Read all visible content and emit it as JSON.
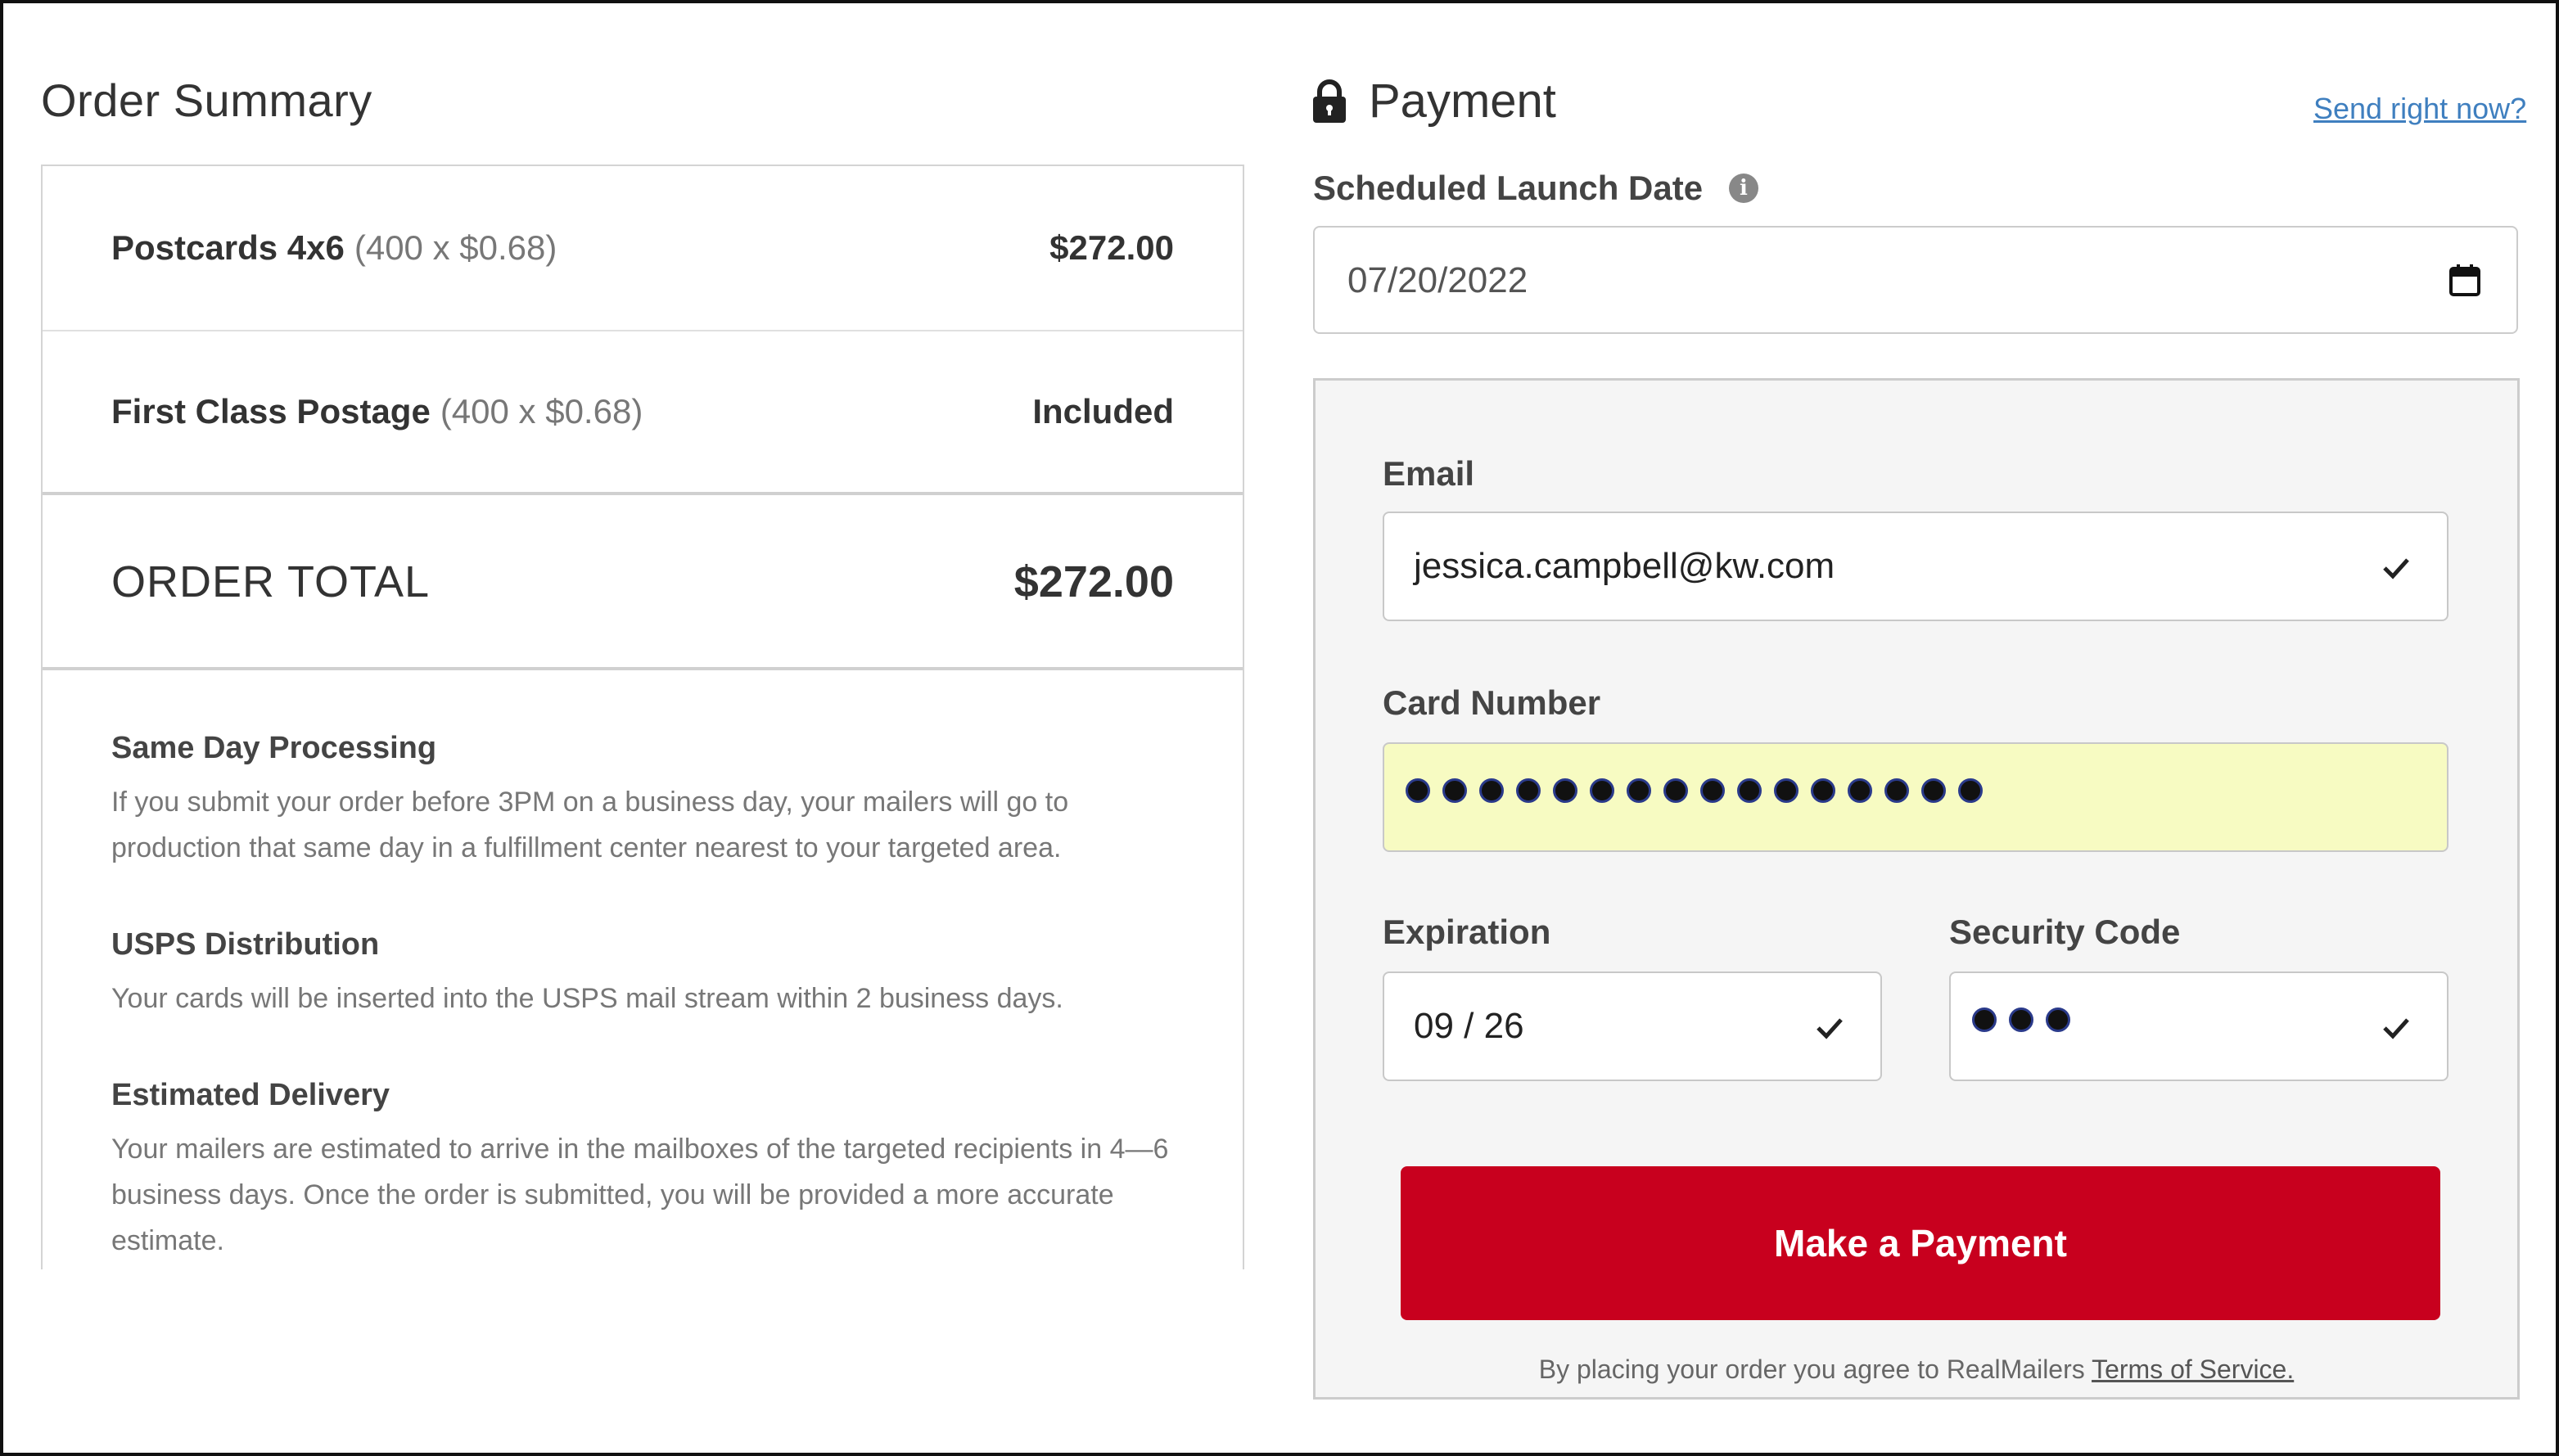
{
  "order_summary": {
    "title": "Order Summary",
    "items": [
      {
        "name": "Postcards 4x6",
        "detail": "(400 x $0.68)",
        "price": "$272.00"
      },
      {
        "name": "First Class Postage",
        "detail": "(400 x $0.68)",
        "price": "Included"
      }
    ],
    "total_label": "ORDER TOTAL",
    "total_value": "$272.00",
    "info": [
      {
        "heading": "Same Day Processing",
        "text": "If you submit your order before 3PM on a business day, your mailers will go to production that same day in a fulfillment center nearest to your targeted area."
      },
      {
        "heading": "USPS Distribution",
        "text": "Your cards will be inserted into the USPS mail stream within 2 business days."
      },
      {
        "heading": "Estimated Delivery",
        "text": "Your mailers are estimated to arrive in the mailboxes of the targeted recipients in 4—6 business days. Once the order is submitted, you will be provided a more accurate estimate."
      }
    ]
  },
  "payment": {
    "title": "Payment",
    "send_now_link": "Send right now?",
    "launch_date_label": "Scheduled Launch Date",
    "launch_date_value": "07/20/2022",
    "info_icon_glyph": "i",
    "email_label": "Email",
    "email_value": "jessica.campbell@kw.com",
    "card_label": "Card Number",
    "card_mask_dot_count": 16,
    "expiration_label": "Expiration",
    "expiration_value": "09 / 26",
    "security_label": "Security Code",
    "security_mask_dot_count": 3,
    "pay_button_label": "Make a Payment",
    "terms_text": "By placing your order you agree to RealMailers",
    "terms_link": "Terms of Service."
  },
  "colors": {
    "accent_button": "#c8001e",
    "autofill_bg": "#f7fbc2",
    "link": "#3f7fbf"
  },
  "icons": [
    "lock-icon",
    "info-icon",
    "calendar-icon",
    "check-icon"
  ]
}
